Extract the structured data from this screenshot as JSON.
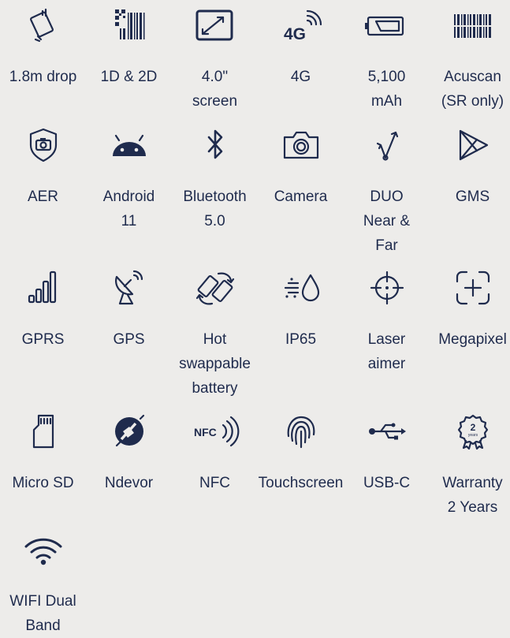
{
  "features": [
    {
      "label": "1.8m drop",
      "icon": "drop-icon"
    },
    {
      "label": "1D & 2D",
      "icon": "barcode-qr-icon"
    },
    {
      "label": "4.0\"\nscreen",
      "icon": "screen-icon"
    },
    {
      "label": "4G",
      "icon": "4g-signal-icon"
    },
    {
      "label": "5,100\nmAh",
      "icon": "battery-icon"
    },
    {
      "label": "Acuscan\n(SR only)",
      "icon": "barcode-icon"
    },
    {
      "label": "AER",
      "icon": "shield-camera-icon"
    },
    {
      "label": "Android\n11",
      "icon": "android-icon"
    },
    {
      "label": "Bluetooth\n5.0",
      "icon": "bluetooth-icon"
    },
    {
      "label": "Camera",
      "icon": "camera-icon"
    },
    {
      "label": "DUO\nNear &\nFar",
      "icon": "near-far-icon"
    },
    {
      "label": "GMS",
      "icon": "play-icon"
    },
    {
      "label": "GPRS",
      "icon": "signal-bars-icon"
    },
    {
      "label": "GPS",
      "icon": "satellite-dish-icon"
    },
    {
      "label": "Hot\nswappable\nbattery",
      "icon": "swap-battery-icon"
    },
    {
      "label": "IP65",
      "icon": "water-dust-icon"
    },
    {
      "label": "Laser\naimer",
      "icon": "crosshair-icon"
    },
    {
      "label": "Megapixel",
      "icon": "focus-frame-icon"
    },
    {
      "label": "Micro SD",
      "icon": "sd-card-icon"
    },
    {
      "label": "Ndevor",
      "icon": "ndevor-icon"
    },
    {
      "label": "NFC",
      "icon": "nfc-icon"
    },
    {
      "label": "Touchscreen",
      "icon": "fingerprint-icon"
    },
    {
      "label": "USB-C",
      "icon": "usb-icon"
    },
    {
      "label": "Warranty\n2 Years",
      "icon": "warranty-badge-icon"
    },
    {
      "label": "WIFI Dual\nBand",
      "icon": "wifi-icon"
    }
  ],
  "warranty_badge": {
    "number": "2",
    "unit": "years"
  },
  "nfc_text": "NFC",
  "g4_text": "4G"
}
